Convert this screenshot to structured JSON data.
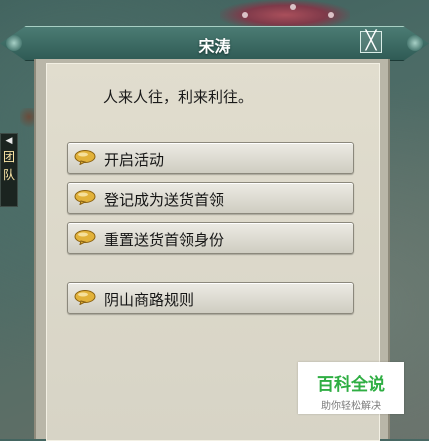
{
  "top_partial_text": "",
  "left_strip": {
    "arrow": "◀",
    "chars": [
      "团",
      "队"
    ]
  },
  "dialog": {
    "title": "宋涛",
    "close_glyph": "╳",
    "greeting": "人来人往，利来利往。",
    "options": [
      {
        "label": "开启活动",
        "icon": "speech-bubble-icon"
      },
      {
        "label": "登记成为送货首领",
        "icon": "speech-bubble-icon"
      },
      {
        "label": "重置送货首领身份",
        "icon": "speech-bubble-icon"
      },
      {
        "label": "阴山商路规则",
        "icon": "speech-bubble-icon"
      }
    ]
  },
  "watermark": {
    "main": "百科全说",
    "sub": "助你轻松解决"
  },
  "colors": {
    "title_bar": "#3f6d66",
    "panel_bg": "#dcd8ca",
    "bubble": "#e2b23a"
  }
}
